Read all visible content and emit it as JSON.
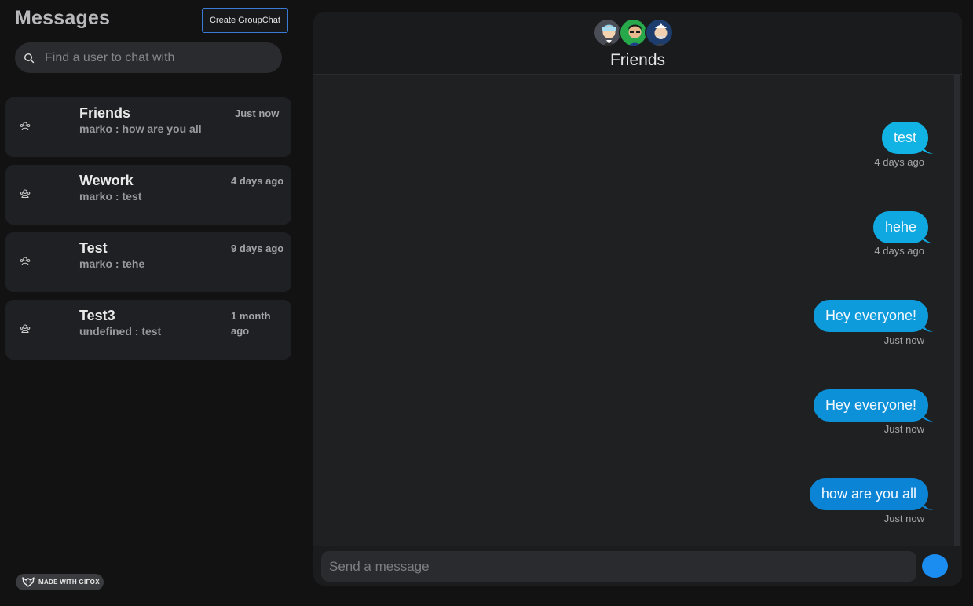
{
  "sidebar": {
    "title": "Messages",
    "create_button": "Create GroupChat",
    "search_placeholder": "Find a user to chat with",
    "chats": [
      {
        "name": "Friends",
        "preview": "marko : how are you all",
        "time": "Just now"
      },
      {
        "name": "Wework",
        "preview": "marko : test",
        "time": "4 days ago"
      },
      {
        "name": "Test",
        "preview": "marko : tehe",
        "time": "9 days ago"
      },
      {
        "name": "Test3",
        "preview": "undefined : test",
        "time": "1 month ago"
      }
    ],
    "badge": "MADE WITH GIFOX"
  },
  "chat": {
    "title": "Friends",
    "messages": [
      {
        "text": "test",
        "time": "4 days ago"
      },
      {
        "text": "hehe",
        "time": "4 days ago"
      },
      {
        "text": "Hey everyone!",
        "time": "Just now"
      },
      {
        "text": "Hey everyone!",
        "time": "Just now"
      },
      {
        "text": "how are you all",
        "time": "Just now"
      }
    ],
    "composer_placeholder": "Send a message"
  },
  "colors": {
    "bubble_light": "#10b3e3",
    "bubble_dark": "#0b84d6",
    "accent": "#1b8cf0",
    "create_border": "#3a7bd5"
  },
  "icons": [
    "search-icon",
    "group-icon",
    "send-icon",
    "gifox-logo-icon"
  ]
}
